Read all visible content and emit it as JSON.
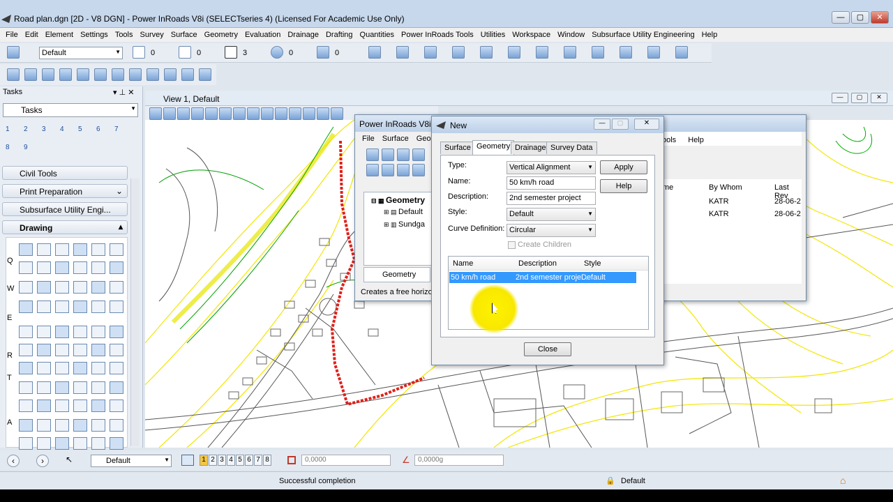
{
  "window": {
    "title": "Road plan.dgn [2D - V8 DGN] - Power InRoads V8i (SELECTseries 4) (Licensed For Academic Use Only)",
    "minimize": "—",
    "maximize": "▢",
    "close": "✕"
  },
  "menu": [
    "File",
    "Edit",
    "Element",
    "Settings",
    "Tools",
    "Survey",
    "Surface",
    "Geometry",
    "Evaluation",
    "Drainage",
    "Drafting",
    "Quantities",
    "Power InRoads Tools",
    "Utilities",
    "Workspace",
    "Window",
    "Subsurface Utility Engineering",
    "Help"
  ],
  "toolbar": {
    "level_combo": "Default",
    "color_value": "0",
    "style_value": "0",
    "weight_value": "3",
    "transparency_value": "0",
    "priority_value": "0"
  },
  "tasks": {
    "header": "Tasks",
    "combo": "Tasks",
    "groups": [
      "Civil Tools",
      "Print Preparation",
      "Subsurface Utility Engi...",
      "Drawing"
    ],
    "row_letters": [
      "Q",
      "W",
      "E",
      "R",
      "T",
      "A"
    ],
    "view_nums": [
      "1",
      "2",
      "3",
      "4",
      "5",
      "6",
      "7",
      "8",
      "9"
    ]
  },
  "view": {
    "title": "View 1, Default"
  },
  "inroads": {
    "title": "Power InRoads V8i (",
    "menu": [
      "File",
      "Surface",
      "Geo"
    ],
    "tree_root": "Geometry",
    "tree_items": [
      "Default",
      "Sundga"
    ],
    "tab": "Geometry",
    "status": "Creates a free horizo",
    "right_menu": [
      "ools",
      "Help"
    ],
    "cols": [
      "me",
      "By Whom",
      "Last Rev"
    ],
    "rows": [
      [
        "KATR",
        "28-06-2"
      ],
      [
        "KATR",
        "28-06-2"
      ]
    ]
  },
  "dialog": {
    "title": "New",
    "tabs": [
      "Surface",
      "Geometry",
      "Drainage",
      "Survey Data"
    ],
    "type_label": "Type:",
    "type_value": "Vertical Alignment",
    "name_label": "Name:",
    "name_value": "50 km/h road",
    "desc_label": "Description:",
    "desc_value": "2nd semester project",
    "style_label": "Style:",
    "style_value": "Default",
    "curve_label": "Curve Definition:",
    "curve_value": "Circular",
    "create_children": "Create Children",
    "apply": "Apply",
    "help": "Help",
    "close": "Close",
    "list_cols": [
      "Name",
      "Description",
      "Style"
    ],
    "list_rows": [
      {
        "name": "50 km/h road",
        "description": "2nd semester proje...",
        "style": "Default"
      }
    ]
  },
  "bottom": {
    "level": "Default",
    "views": [
      "1",
      "2",
      "3",
      "4",
      "5",
      "6",
      "7",
      "8"
    ],
    "coord": "0,0000",
    "angle": "0,0000g"
  },
  "status": {
    "message": "Successful completion",
    "level": "Default"
  },
  "colors": {
    "accent": "#3399ff",
    "road": "#e0201a",
    "contour": "#f2e600"
  }
}
